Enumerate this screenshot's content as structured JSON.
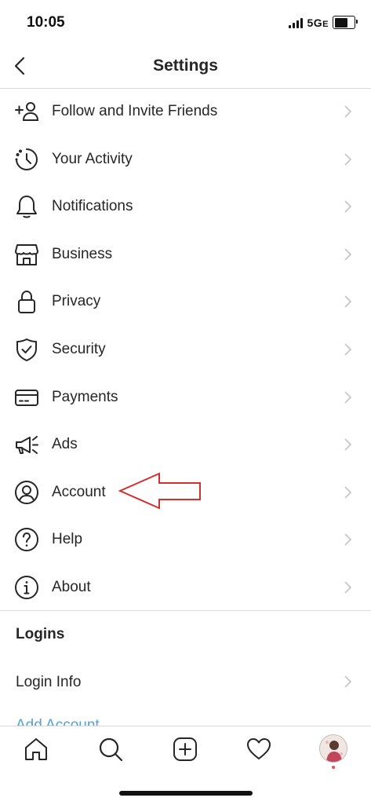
{
  "status_bar": {
    "time": "10:05",
    "network": "5G",
    "network_suffix": "E"
  },
  "header": {
    "title": "Settings"
  },
  "menu": [
    {
      "label": "Follow and Invite Friends",
      "icon": "add-person-icon"
    },
    {
      "label": "Your Activity",
      "icon": "activity-clock-icon"
    },
    {
      "label": "Notifications",
      "icon": "bell-icon"
    },
    {
      "label": "Business",
      "icon": "storefront-icon"
    },
    {
      "label": "Privacy",
      "icon": "lock-icon"
    },
    {
      "label": "Security",
      "icon": "shield-icon"
    },
    {
      "label": "Payments",
      "icon": "card-icon"
    },
    {
      "label": "Ads",
      "icon": "megaphone-icon"
    },
    {
      "label": "Account",
      "icon": "account-icon"
    },
    {
      "label": "Help",
      "icon": "help-icon"
    },
    {
      "label": "About",
      "icon": "info-icon"
    }
  ],
  "logins": {
    "section_title": "Logins",
    "login_info": "Login Info",
    "add_account_peek": "Add Account"
  },
  "colors": {
    "annotation_arrow": "#d32f2f",
    "link_blue": "#4fa3d9",
    "divider": "#dbdbdb"
  },
  "tab_bar": [
    "home-icon",
    "search-icon",
    "new-post-icon",
    "heart-icon",
    "profile-avatar"
  ]
}
